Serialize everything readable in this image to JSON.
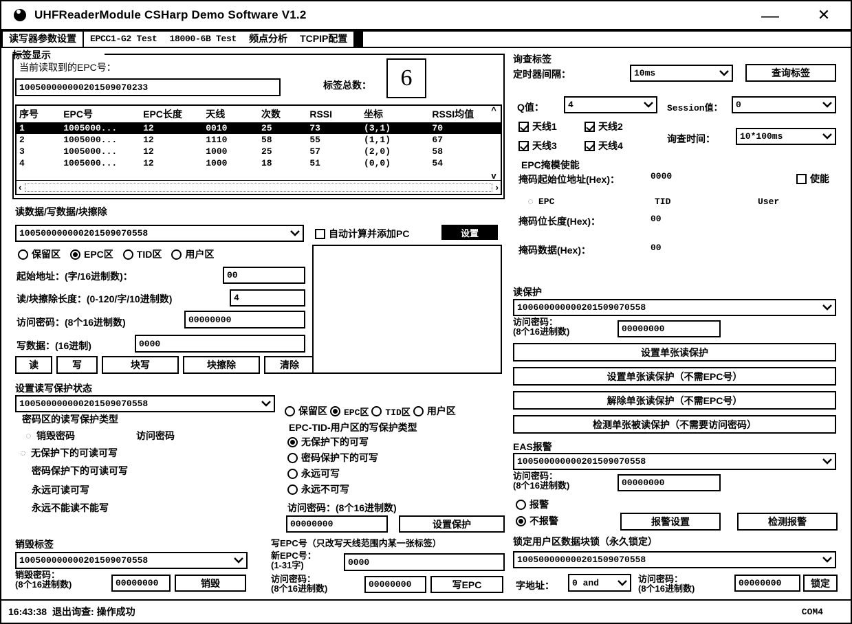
{
  "window": {
    "title": "UHFReaderModule CSHarp Demo Software V1.2",
    "icon": "app-circle-icon",
    "minimize_label": "—",
    "close_label": "✕"
  },
  "tabs": [
    {
      "label": "读写器参数设置",
      "selected": true,
      "mono": false
    },
    {
      "label": "EPCC1-G2 Test",
      "selected": false,
      "mono": true
    },
    {
      "label": "18000-6B Test",
      "selected": false,
      "mono": true
    },
    {
      "label": "频点分析",
      "selected": false,
      "mono": false
    },
    {
      "label": "TCPIP配置",
      "selected": false,
      "mono": false
    }
  ],
  "tag_display": {
    "group_title": "标签显示",
    "current_epc_label": "当前读取到的EPC号：",
    "current_epc_value": "100500000000201509070233",
    "total_label": "标签总数：",
    "total_value": "6",
    "columns": [
      "序号",
      "EPC号",
      "EPC长度",
      "天线",
      "次数",
      "RSSI",
      "坐标",
      "RSSI均值"
    ],
    "rows": [
      {
        "no": "1",
        "epc": "1005000...",
        "len": "12",
        "ant": "0010",
        "count": "25",
        "rssi": "73",
        "coord": "(3,1)",
        "rssi_avg": "70",
        "selected": true
      },
      {
        "no": "2",
        "epc": "1005000...",
        "len": "12",
        "ant": "1110",
        "count": "58",
        "rssi": "55",
        "coord": "(1,1)",
        "rssi_avg": "67",
        "selected": false
      },
      {
        "no": "3",
        "epc": "1005000...",
        "len": "12",
        "ant": "1000",
        "count": "25",
        "rssi": "57",
        "coord": "(2,0)",
        "rssi_avg": "58",
        "selected": false
      },
      {
        "no": "4",
        "epc": "1005000...",
        "len": "12",
        "ant": "1000",
        "count": "18",
        "rssi": "51",
        "coord": "(0,0)",
        "rssi_avg": "54",
        "selected": false
      }
    ],
    "scroll_up": "^",
    "scroll_down": "v",
    "scroll_left": "‹",
    "scroll_right": "›"
  },
  "rw_section": {
    "group_title": "读数据/写数据/块擦除",
    "epc_combo_value": "100500000000201509070558",
    "areas": [
      {
        "label": "保留区",
        "selected": false
      },
      {
        "label": "EPC区",
        "selected": true
      },
      {
        "label": "TID区",
        "selected": false
      },
      {
        "label": "用户区",
        "selected": false
      }
    ],
    "start_addr_label": "起始地址：(字/16进制数)：",
    "start_addr_value": "00",
    "length_label": "读/块擦除长度：(0-120/字/10进制数)",
    "length_value": "4",
    "access_pwd_label": "访问密码：(8个16进制数)",
    "access_pwd_value": "00000000",
    "write_data_label": "写数据：(16进制)",
    "write_data_value": "0000",
    "buttons": [
      "读",
      "写",
      "块写",
      "块擦除",
      "清除"
    ],
    "auto_pc_checkbox_label": "自动计算并添加PC",
    "auto_pc_checked": false,
    "auto_pc_button_label": "设置",
    "output_text": ""
  },
  "protect_state": {
    "group_title": "设置读写保护状态",
    "epc_combo_value": "100500000000201509070558",
    "pwd_area_title": "密码区的读写保护类型",
    "pwd_kinds": [
      {
        "label": "销毁密码",
        "selected": false
      },
      {
        "label": "访问密码",
        "selected": false
      }
    ],
    "pwd_options": [
      {
        "label": "无保护下的可读可写",
        "selected": true
      },
      {
        "label": "密码保护下的可读可写",
        "selected": false
      },
      {
        "label": "永远可读可写",
        "selected": false
      },
      {
        "label": "永远不能读不能写",
        "selected": false
      }
    ],
    "right_areas": [
      {
        "label": "保留区",
        "selected": false
      },
      {
        "label": "EPC区",
        "selected": true
      },
      {
        "label": "TID区",
        "selected": false
      },
      {
        "label": "用户区",
        "selected": false
      }
    ],
    "right_title": "EPC-TID-用户区的写保护类型",
    "right_options": [
      {
        "label": "无保护下的可写",
        "selected": true
      },
      {
        "label": "密码保护下的可写",
        "selected": false
      },
      {
        "label": "永远可写",
        "selected": false
      },
      {
        "label": "永远不可写",
        "selected": false
      }
    ],
    "access_pwd_label": "访问密码：(8个16进制数)",
    "access_pwd_value": "00000000",
    "set_protect_button": "设置保护"
  },
  "kill_tag": {
    "group_title": "销毁标签",
    "epc_combo_value": "100500000000201509070558",
    "kill_pwd_label_line1": "销毁密码：",
    "kill_pwd_label_line2": "(8个16进制数)",
    "kill_pwd_value": "00000000",
    "kill_button": "销毁"
  },
  "write_epc": {
    "group_title": "写EPC号（只改写天线范围内某一张标签）",
    "epc_label_line1": "新EPC号：",
    "epc_label_line2": "(1-31字)",
    "epc_value": "0000",
    "access_pwd_label_line1": "访问密码：",
    "access_pwd_label_line2": "(8个16进制数)",
    "access_pwd_value": "00000000",
    "write_button": "写EPC"
  },
  "inventory": {
    "group_title": "询查标签",
    "timer_label": "定时器间隔：",
    "timer_value": "10ms",
    "query_button": "查询标签",
    "q_label": "Q值：",
    "q_value": "4",
    "session_label": "Session值：",
    "session_value": "0",
    "antennas": [
      {
        "label": "天线1",
        "checked": true
      },
      {
        "label": "天线2",
        "checked": true
      },
      {
        "label": "天线3",
        "checked": true
      },
      {
        "label": "天线4",
        "checked": true
      }
    ],
    "query_time_label": "询查时间：",
    "query_time_value": "10*100ms",
    "mask_title": "EPC掩模使能",
    "mask_start_label": "掩码起始位地址(Hex)：",
    "mask_start_value": "0000",
    "enable_label": "使能",
    "enable_checked": false,
    "mask_banks": [
      {
        "label": "EPC",
        "selected": true
      },
      {
        "label": "TID",
        "selected": false
      },
      {
        "label": "User",
        "selected": false
      }
    ],
    "mask_len_label": "掩码位长度(Hex)：",
    "mask_len_value": "00",
    "mask_data_label": "掩码数据(Hex)：",
    "mask_data_value": "00"
  },
  "read_protect": {
    "group_title": "读保护",
    "epc_combo_value": "100600000000201509070558",
    "access_pwd_label_line1": "访问密码：",
    "access_pwd_label_line2": "(8个16进制数)",
    "access_pwd_value": "00000000",
    "buttons": [
      "设置单张读保护",
      "设置单张读保护（不需EPC号）",
      "解除单张读保护（不需EPC号）",
      "检测单张被读保护（不需要访问密码）"
    ]
  },
  "eas_alarm": {
    "group_title": "EAS报警",
    "epc_combo_value": "100500000000201509070558",
    "access_pwd_label_line1": "访问密码：",
    "access_pwd_label_line2": "(8个16进制数)",
    "access_pwd_value": "00000000",
    "options": [
      {
        "label": "报警",
        "selected": false
      },
      {
        "label": "不报警",
        "selected": true
      }
    ],
    "alarm_settings_button": "报警设置",
    "detect_alarm_button": "检测报警"
  },
  "lock_user": {
    "group_title": "锁定用户区数据块锁（永久锁定）",
    "epc_combo_value": "100500000000201509070558",
    "word_addr_label": "字地址：",
    "word_addr_value": "0 and",
    "access_pwd_label_line1": "访问密码：",
    "access_pwd_label_line2": "(8个16进制数)",
    "access_pwd_value": "00000000",
    "lock_button": "锁定"
  },
  "status": {
    "time": "16:43:38",
    "message": "退出询查: 操作成功",
    "port": "COM4"
  }
}
